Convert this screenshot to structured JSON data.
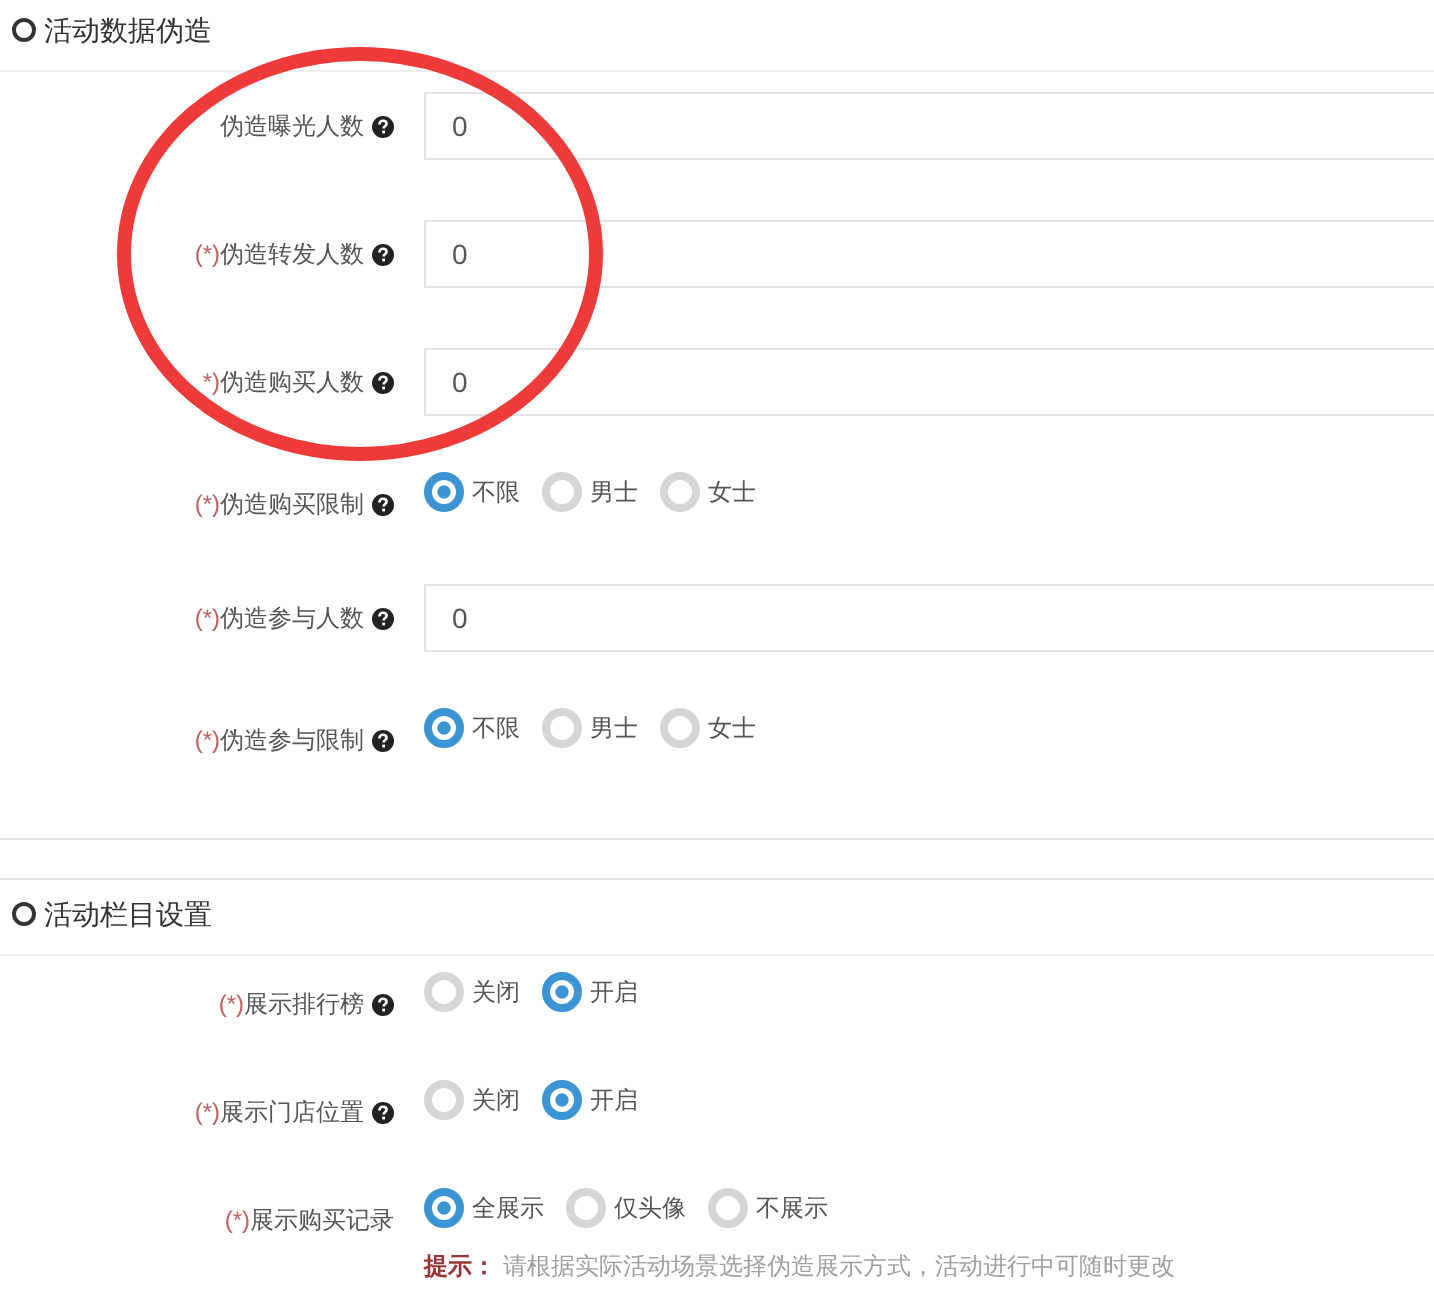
{
  "sections": [
    {
      "title": "活动数据伪造",
      "fields": [
        {
          "kind": "input",
          "label": "伪造曝光人数",
          "help": true,
          "value": "0"
        },
        {
          "kind": "input",
          "required_mark": "(*)",
          "label": "伪造转发人数",
          "help": true,
          "value": "0"
        },
        {
          "kind": "input",
          "required_mark": "*)",
          "label": "伪造购买人数",
          "help": true,
          "value": "0"
        },
        {
          "kind": "radio",
          "required_mark": "(*)",
          "label": "伪造购买限制",
          "help": true,
          "options": [
            {
              "label": "不限",
              "selected": true
            },
            {
              "label": "男士",
              "selected": false
            },
            {
              "label": "女士",
              "selected": false
            }
          ]
        },
        {
          "kind": "input",
          "required_mark": "(*)",
          "label": "伪造参与人数",
          "help": true,
          "value": "0"
        },
        {
          "kind": "radio",
          "required_mark": "(*)",
          "label": "伪造参与限制",
          "help": true,
          "options": [
            {
              "label": "不限",
              "selected": true
            },
            {
              "label": "男士",
              "selected": false
            },
            {
              "label": "女士",
              "selected": false
            }
          ]
        }
      ]
    },
    {
      "title": "活动栏目设置",
      "fields": [
        {
          "kind": "radio",
          "required_mark": "(*)",
          "label": "展示排行榜",
          "help": true,
          "options": [
            {
              "label": "关闭",
              "selected": false
            },
            {
              "label": "开启",
              "selected": true
            }
          ]
        },
        {
          "kind": "radio",
          "required_mark": "(*)",
          "label": "展示门店位置",
          "help": true,
          "options": [
            {
              "label": "关闭",
              "selected": false
            },
            {
              "label": "开启",
              "selected": true
            }
          ]
        },
        {
          "kind": "radio",
          "required_mark": "(*)",
          "label": "展示购买记录",
          "options": [
            {
              "label": "全展示",
              "selected": true
            },
            {
              "label": "仅头像",
              "selected": false
            },
            {
              "label": "不展示",
              "selected": false
            }
          ],
          "hint": "**提示：** 请根据实际活动场景选择伪造展示方式，活动进行中可随时更改"
        }
      ]
    }
  ],
  "annotations": [
    {
      "kind": "ellipse"
    }
  ]
}
